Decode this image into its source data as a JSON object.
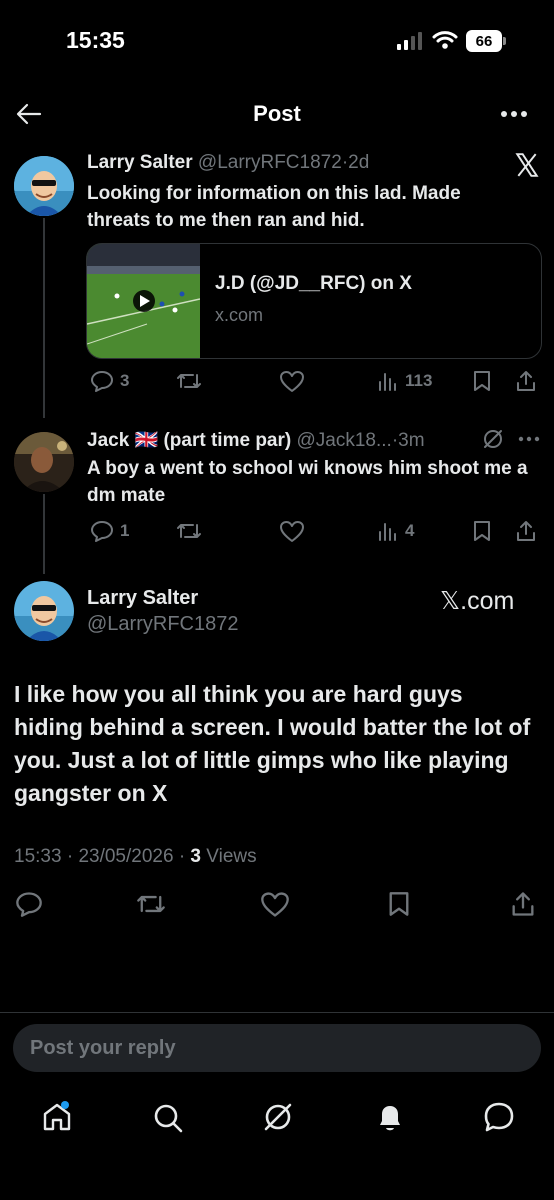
{
  "status_bar": {
    "time": "15:35",
    "battery": "66"
  },
  "header": {
    "title": "Post"
  },
  "tweet1": {
    "name": "Larry Salter",
    "handle": "@LarryRFC1872",
    "sep": "·",
    "age": "2d",
    "text": "Looking for information on this lad. Made threats to me then ran and hid.",
    "card": {
      "title": "J.D (@JD__RFC) on X",
      "domain": "x.com"
    },
    "replies": "3",
    "views": "113"
  },
  "tweet2": {
    "name": "Jack 🇬🇧 (part time par)",
    "handle": "@Jack18...",
    "sep": "·",
    "age": "3m",
    "text": "A boy a went to school wi knows him shoot me a dm mate",
    "replies": "1",
    "views": "4"
  },
  "main": {
    "name": "Larry Salter",
    "handle": "@LarryRFC1872",
    "badge": "𝕏.com",
    "text": "I like how you all think you are hard guys hiding behind a screen. I would batter the lot of you. Just a lot of little gimps who like playing gangster on X",
    "time": "15:33",
    "date": "23/05/2026",
    "views_count": "3",
    "views_label": "Views"
  },
  "reply": {
    "placeholder": "Post your reply"
  },
  "colors": {
    "bg": "#000000",
    "text": "#e7e9ea",
    "muted": "#71767b",
    "accent": "#1d9bf0",
    "input_bg": "#202327"
  }
}
